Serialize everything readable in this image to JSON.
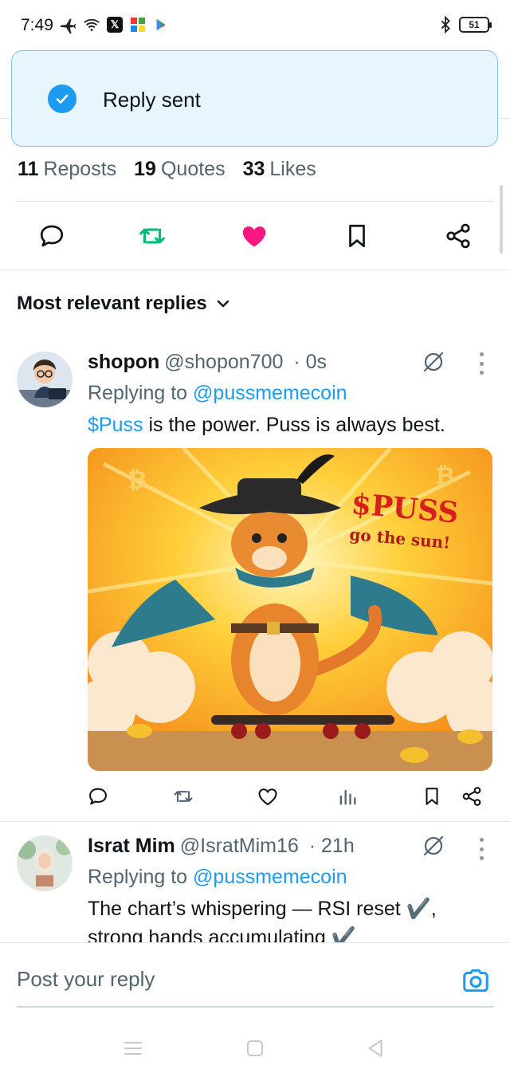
{
  "status_bar": {
    "time": "7:49",
    "battery": "51"
  },
  "toast": {
    "message": "Reply sent"
  },
  "stats": {
    "reposts_count": "11",
    "reposts_label": "Reposts",
    "quotes_count": "19",
    "quotes_label": "Quotes",
    "likes_count": "33",
    "likes_label": "Likes"
  },
  "actions": {
    "icons": [
      "reply-icon",
      "repost-icon",
      "like-icon",
      "bookmark-icon",
      "share-icon"
    ],
    "repost_color": "#00ba7c",
    "like_color": "#f91880"
  },
  "section": {
    "title": "Most relevant replies"
  },
  "replies": [
    {
      "name": "shopon",
      "handle": "@shopon700",
      "time": "· 0s",
      "replying_prefix": "Replying to",
      "mention": "@pussmemecoin",
      "cashtag": "$Puss",
      "text": "is the power. Puss is always best.",
      "media": {
        "title": "$PUSS",
        "subtitle": "go the sun!"
      }
    },
    {
      "name": "Israt Mim",
      "handle": "@IsratMim16",
      "time": "· 21h",
      "replying_prefix": "Replying to",
      "mention": "@pussmemecoin",
      "text_line1": "The chart’s whispering — RSI reset ✔️,",
      "text_line2": "strong hands accumulating ✔️"
    }
  ],
  "composer": {
    "placeholder": "Post your reply"
  },
  "colors": {
    "accent": "#1d9bf0",
    "toast_bg": "#e7f5fd",
    "text_secondary": "#536471"
  }
}
